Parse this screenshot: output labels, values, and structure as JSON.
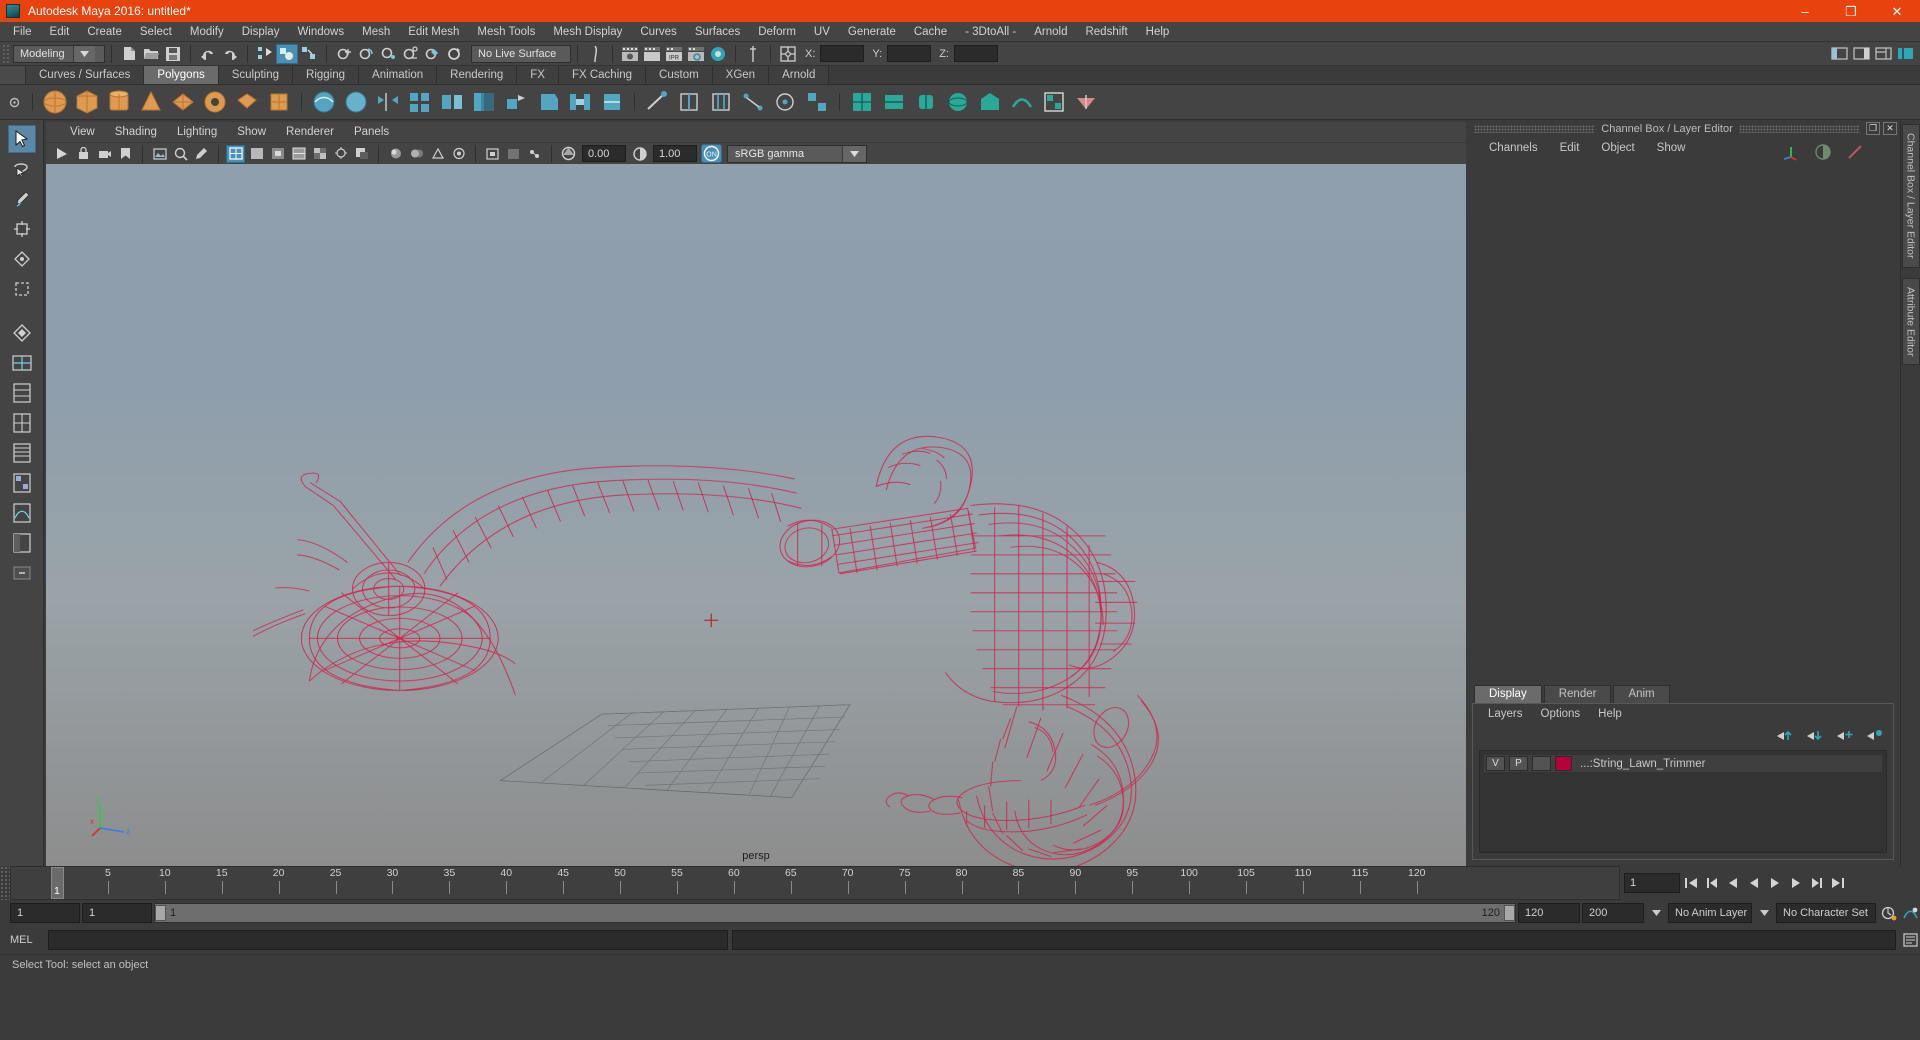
{
  "window": {
    "title": "Autodesk Maya 2016: untitled*",
    "minimize": "–",
    "maximize": "❐",
    "close": "✕",
    "accent": "#e8430f"
  },
  "menubar": {
    "items": [
      {
        "label": "File"
      },
      {
        "label": "Edit"
      },
      {
        "label": "Create"
      },
      {
        "label": "Select"
      },
      {
        "label": "Modify"
      },
      {
        "label": "Display"
      },
      {
        "label": "Windows"
      },
      {
        "label": "Mesh"
      },
      {
        "label": "Edit Mesh"
      },
      {
        "label": "Mesh Tools"
      },
      {
        "label": "Mesh Display"
      },
      {
        "label": "Curves"
      },
      {
        "label": "Surfaces"
      },
      {
        "label": "Deform"
      },
      {
        "label": "UV"
      },
      {
        "label": "Generate"
      },
      {
        "label": "Cache"
      },
      {
        "label": "- 3DtoAll -"
      },
      {
        "label": "Arnold"
      },
      {
        "label": "Redshift"
      },
      {
        "label": "Help"
      }
    ]
  },
  "statusline": {
    "menuset": "Modeling",
    "live_surface": "No Live Surface",
    "axis": {
      "x_label": "X:",
      "y_label": "Y:",
      "z_label": "Z:",
      "x_value": "",
      "y_value": "",
      "z_value": ""
    }
  },
  "shelf": {
    "tabs": [
      {
        "label": "Curves / Surfaces",
        "active": false
      },
      {
        "label": "Polygons",
        "active": true
      },
      {
        "label": "Sculpting",
        "active": false
      },
      {
        "label": "Rigging",
        "active": false
      },
      {
        "label": "Animation",
        "active": false
      },
      {
        "label": "Rendering",
        "active": false
      },
      {
        "label": "FX",
        "active": false
      },
      {
        "label": "FX Caching",
        "active": false
      },
      {
        "label": "Custom",
        "active": false
      },
      {
        "label": "XGen",
        "active": false
      },
      {
        "label": "Arnold",
        "active": false
      }
    ]
  },
  "viewport": {
    "menu": [
      {
        "label": "View"
      },
      {
        "label": "Shading"
      },
      {
        "label": "Lighting"
      },
      {
        "label": "Show"
      },
      {
        "label": "Renderer"
      },
      {
        "label": "Panels"
      }
    ],
    "exposure": "0.00",
    "gamma": "1.00",
    "color_toggle": "ON",
    "color_profile": "sRGB gamma",
    "camera_label": "persp",
    "axis_x": "x",
    "axis_y": "y",
    "axis_z": "z",
    "model_color": "#d31e4a",
    "bg_top": "#8f9fae",
    "bg_bottom": "#8d8d8d"
  },
  "right_panel": {
    "title": "Channel Box / Layer Editor",
    "undock": "❐",
    "close": "✕",
    "channel_menu": [
      {
        "label": "Channels"
      },
      {
        "label": "Edit"
      },
      {
        "label": "Object"
      },
      {
        "label": "Show"
      }
    ],
    "vertical_tabs": [
      {
        "label": "Channel Box / Layer Editor"
      },
      {
        "label": "Attribute Editor"
      }
    ],
    "layer_editor": {
      "tabs": [
        {
          "label": "Display",
          "active": true
        },
        {
          "label": "Render",
          "active": false
        },
        {
          "label": "Anim",
          "active": false
        }
      ],
      "menu": [
        {
          "label": "Layers"
        },
        {
          "label": "Options"
        },
        {
          "label": "Help"
        }
      ],
      "layers": [
        {
          "visibility": "V",
          "playback": "P",
          "shading": "",
          "color": "#b5003c",
          "name": "...:String_Lawn_Trimmer"
        }
      ]
    }
  },
  "timeline": {
    "current_frame": "1",
    "tick_labels": [
      "5",
      "10",
      "15",
      "20",
      "25",
      "30",
      "35",
      "40",
      "45",
      "50",
      "55",
      "60",
      "65",
      "70",
      "75",
      "80",
      "85",
      "90",
      "95",
      "100",
      "105",
      "110",
      "115",
      "120"
    ],
    "frame_field": "1",
    "range_start": "1",
    "range_start2": "1",
    "range_slider_min": "1",
    "range_slider_max": "120",
    "range_end": "120",
    "playback_end": "200",
    "anim_layer": "No Anim Layer",
    "character_set": "No Character Set"
  },
  "command_line": {
    "label": "MEL",
    "value": "",
    "placeholder": ""
  },
  "status": {
    "help_text": "Select Tool: select an object"
  }
}
